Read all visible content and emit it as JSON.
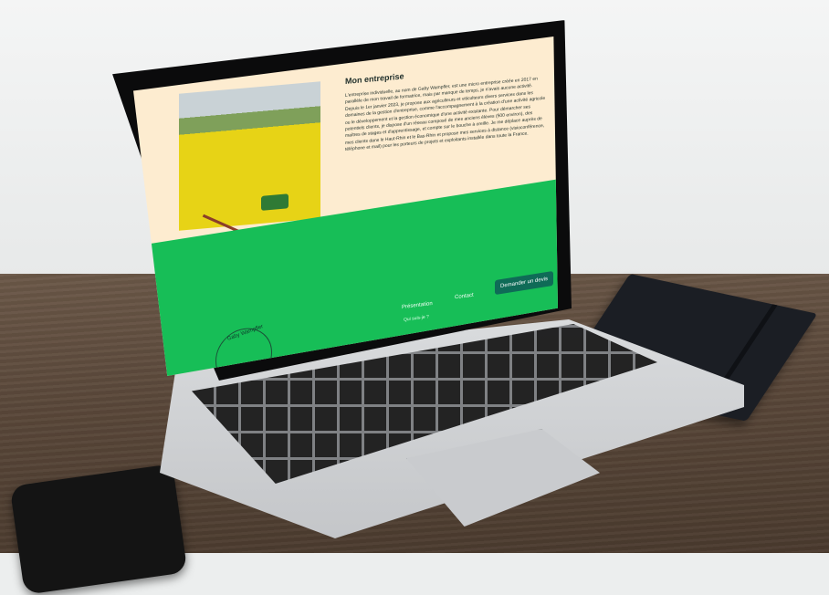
{
  "screen": {
    "heading": "Mon entreprise",
    "paragraph": "L'entreprise individuelle, au nom de Gaby Wampfler, est une micro entreprise créée en 2017 en parallèle de mon travail de formatrice, mais par manque de temps, je n'avais aucune activité. Depuis le 1er janvier 2023, je propose aux agriculteurs et viticulteurs divers services dans les domaines de la gestion d'entreprise, comme l'accompagnement à la création d'une activité agricole ou le développement et la gestion économique d'une activité existante. Pour démarcher ses potentiels clients, je dispose d'un réseau composé de mes anciens élèves (500 environ), des maîtres de stages et d'apprentissage, et compte sur le bouche à oreille. Je me déplace auprès de mes clients dans le Haut-Rhin et le Bas-Rhin et propose mes services à distance (visioconférence, téléphone et mail) pour les porteurs de projets et exploitants installés dans toute la France.",
    "nav": {
      "presentation": "Présentation",
      "contact": "Contact",
      "subnav": "Qui suis-je ?",
      "cta": "Demander un devis"
    },
    "logo_text": "Gaby Wampfler"
  },
  "colors": {
    "screen_bg": "#fdecd0",
    "footer_green": "#17be57",
    "button": "#0f6b57"
  }
}
